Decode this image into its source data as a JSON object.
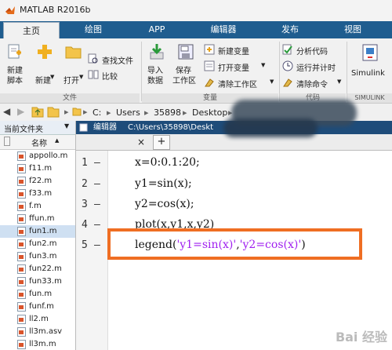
{
  "window": {
    "title": "MATLAB R2016b"
  },
  "tabs": [
    {
      "label": "主页",
      "active": true
    },
    {
      "label": "绘图",
      "active": false
    },
    {
      "label": "APP",
      "active": false
    },
    {
      "label": "编辑器",
      "active": false
    },
    {
      "label": "发布",
      "active": false
    },
    {
      "label": "视图",
      "active": false
    }
  ],
  "ribbon": {
    "file": {
      "new_script": [
        "新建",
        "脚本"
      ],
      "new": "新建",
      "open": "打开",
      "find_files": "查找文件",
      "compare": "比较",
      "group": "文件"
    },
    "variable": {
      "import": [
        "导入",
        "数据"
      ],
      "save_workspace": [
        "保存",
        "工作区"
      ],
      "new_variable": "新建变量",
      "open_variable": "打开变量",
      "clear_workspace": "清除工作区",
      "group": "变量"
    },
    "code": {
      "analyze": "分析代码",
      "run_time": "运行并计时",
      "clear_commands": "清除命令",
      "group": "代码"
    },
    "simulink": {
      "label": "Simulink",
      "group": "SIMULINK"
    }
  },
  "address": {
    "segments": [
      "C:",
      "Users",
      "35898",
      "Desktop"
    ]
  },
  "file_panel": {
    "title": "当前文件夹",
    "column": "名称",
    "files": [
      "appollo.m",
      "f11.m",
      "f22.m",
      "f33.m",
      "f.m",
      "ffun.m",
      "fun1.m",
      "fun2.m",
      "fun3.m",
      "fun22.m",
      "fun33.m",
      "fun.m",
      "funf.m",
      "ll2.m",
      "ll3m.asv",
      "ll3m.m"
    ],
    "selected": "fun1.m"
  },
  "editor": {
    "title_prefix": "编辑器",
    "title_path": "C:\\Users\\35898\\Deskt",
    "tab_close": "×",
    "tab_add": "+",
    "lines": [
      {
        "n": "1",
        "code": "x=0:0.1:20;"
      },
      {
        "n": "2",
        "code": "y1=sin(x);"
      },
      {
        "n": "3",
        "code": "y2=cos(x);"
      },
      {
        "n": "4",
        "code": "plot(x,y1,x,y2)"
      },
      {
        "n": "5",
        "pre": "legend(",
        "s1": "'y1=sin(x)'",
        "mid": ",",
        "s2": "'y2=cos(x)'",
        "post": ")"
      }
    ]
  },
  "watermark": "Bai 经验"
}
